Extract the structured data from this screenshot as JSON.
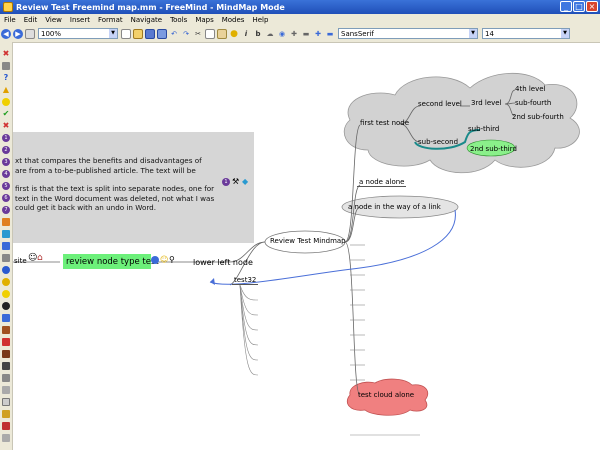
{
  "window": {
    "title": "Review Test Freemind map.mm - FreeMind - MindMap Mode",
    "min": "_",
    "max": "□",
    "close": "×"
  },
  "menu": [
    "File",
    "Edit",
    "View",
    "Insert",
    "Format",
    "Navigate",
    "Tools",
    "Maps",
    "Modes",
    "Help"
  ],
  "toolbar": {
    "zoom": "100%",
    "font": "SansSerif",
    "size": "14"
  },
  "note": {
    "lines1": "xt that compares the benefits and disadvantages of are from a to-be-published article. The text will be",
    "l1a": "xt that compares the benefits and disadvantages of",
    "l1b": "are from a to-be-published article. The text will be",
    "l2a": "first is that the text is split into separate nodes, one for",
    "l2b": "text in the Word document was deleted, not what I was",
    "l2c": "could get it back with an undo in Word."
  },
  "nodes": {
    "root": "Review Test Mindmap",
    "site": "site",
    "review": "review node type test",
    "lower_left": "lower left node",
    "test": "test32",
    "first_test": "first test node",
    "second_level": "second level",
    "third_level": "3rd level",
    "fourth_level": "4th level",
    "sub_fourth": "sub-fourth",
    "second_sub_fourth": "2nd sub-fourth",
    "sub_second": "sub-second",
    "sub_third": "sub-third",
    "second_sub_third": "2nd sub-third",
    "alone": "a node alone",
    "in_way": "a node in the way of a link",
    "cloud_alone": "test cloud alone"
  },
  "colors": {
    "cloud": "#d2d2d2",
    "green": "#6cf07a",
    "red": "#f08080",
    "link": "#4a6fd8",
    "teal": "#1a8a8a"
  }
}
